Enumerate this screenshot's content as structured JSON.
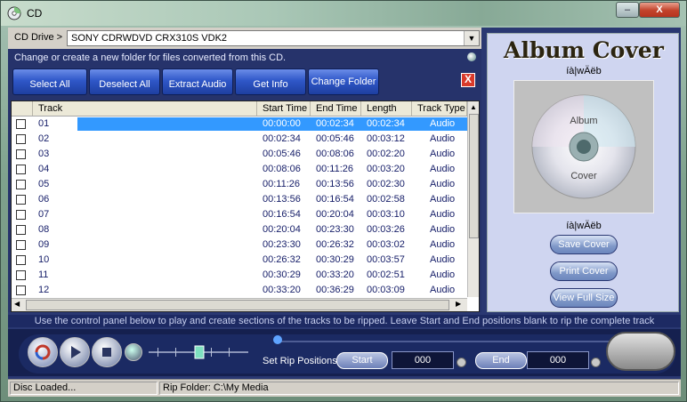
{
  "window": {
    "title": "CD",
    "minimize_label": "–",
    "close_label": "X"
  },
  "cd_drive": {
    "label": "CD Drive >",
    "value": "SONY CDRWDVD CRX310S VDK2"
  },
  "hint": "Change or create a new folder for files converted from this CD.",
  "toolbar": {
    "select_all": "Select All",
    "deselect_all": "Deselect All",
    "extract_audio": "Extract Audio",
    "get_info": "Get Info",
    "change_folder": "Change Folder",
    "close_label": "X"
  },
  "tracklist": {
    "headers": {
      "track": "Track",
      "start": "Start Time",
      "end": "End Time",
      "length": "Length",
      "type": "Track Type"
    },
    "rows": [
      {
        "track": "01",
        "start": "00:00:00",
        "end": "00:02:34",
        "length": "00:02:34",
        "type": "Audio",
        "selected": true
      },
      {
        "track": "02",
        "start": "00:02:34",
        "end": "00:05:46",
        "length": "00:03:12",
        "type": "Audio"
      },
      {
        "track": "03",
        "start": "00:05:46",
        "end": "00:08:06",
        "length": "00:02:20",
        "type": "Audio"
      },
      {
        "track": "04",
        "start": "00:08:06",
        "end": "00:11:26",
        "length": "00:03:20",
        "type": "Audio"
      },
      {
        "track": "05",
        "start": "00:11:26",
        "end": "00:13:56",
        "length": "00:02:30",
        "type": "Audio"
      },
      {
        "track": "06",
        "start": "00:13:56",
        "end": "00:16:54",
        "length": "00:02:58",
        "type": "Audio"
      },
      {
        "track": "07",
        "start": "00:16:54",
        "end": "00:20:04",
        "length": "00:03:10",
        "type": "Audio"
      },
      {
        "track": "08",
        "start": "00:20:04",
        "end": "00:23:30",
        "length": "00:03:26",
        "type": "Audio"
      },
      {
        "track": "09",
        "start": "00:23:30",
        "end": "00:26:32",
        "length": "00:03:02",
        "type": "Audio"
      },
      {
        "track": "10",
        "start": "00:26:32",
        "end": "00:30:29",
        "length": "00:03:57",
        "type": "Audio"
      },
      {
        "track": "11",
        "start": "00:30:29",
        "end": "00:33:20",
        "length": "00:02:51",
        "type": "Audio"
      },
      {
        "track": "12",
        "start": "00:33:20",
        "end": "00:36:29",
        "length": "00:03:09",
        "type": "Audio"
      }
    ]
  },
  "album": {
    "title": "Album Cover",
    "artist_top": "íà|wÄëb",
    "artist_bottom": "íà|wÄëb",
    "placeholder_top": "Album",
    "placeholder_bottom": "Cover",
    "save_cover": "Save Cover",
    "print_cover": "Print Cover",
    "view_full_size": "View Full Size"
  },
  "info_text": "Use the control panel below to play and create sections of the tracks to be ripped. Leave Start and End positions blank to rip the complete track",
  "controls": {
    "set_rip_positions": "Set Rip Positions",
    "start_label": "Start",
    "start_value": "000",
    "end_label": "End",
    "end_value": "000"
  },
  "status": {
    "left": "Disc Loaded...",
    "right": "Rip Folder: C:\\My Media"
  }
}
